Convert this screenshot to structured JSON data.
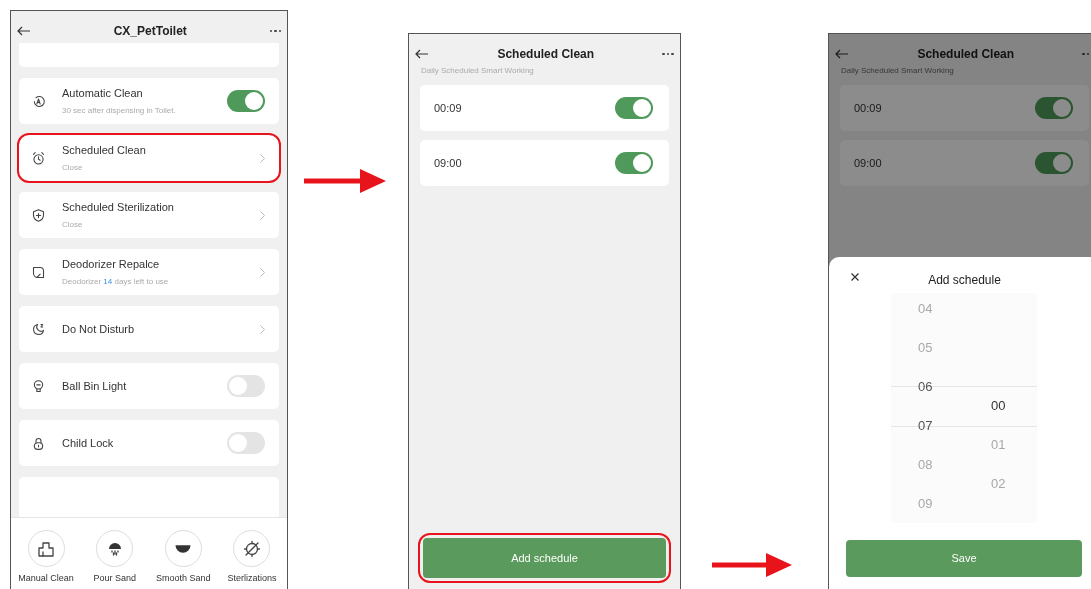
{
  "screens": [
    {
      "kind": "settings",
      "title": "CX_PetToilet",
      "rows": [
        {
          "kind": "blank"
        },
        {
          "kind": "toggle",
          "label": "Automatic Clean",
          "subtitle": [
            {
              "text": "30 sec after dispensing in Toilet.",
              "highlight": false
            }
          ],
          "on": true,
          "callout": false
        },
        {
          "kind": "link",
          "label": "Scheduled Clean",
          "subtitle": [
            {
              "text": "Close",
              "highlight": false
            }
          ],
          "callout": true
        },
        {
          "kind": "link",
          "label": "Scheduled Sterilization",
          "subtitle": [
            {
              "text": "Close",
              "highlight": false
            }
          ],
          "callout": false
        },
        {
          "kind": "link",
          "label": "Deodorizer Repalce",
          "subtitle": [
            {
              "text": "Deodorizer ",
              "highlight": false
            },
            {
              "text": "14",
              "highlight": true
            },
            {
              "text": " days left to use",
              "highlight": false
            }
          ],
          "callout": false
        },
        {
          "kind": "link",
          "label": "Do Not Disturb",
          "callout": false
        },
        {
          "kind": "toggle",
          "label": "Ball Bin Light",
          "on": false,
          "callout": false
        },
        {
          "kind": "toggle",
          "label": "Child Lock",
          "on": false,
          "callout": false
        },
        {
          "kind": "blank"
        }
      ],
      "actions": [
        {
          "label": "Manual Clean"
        },
        {
          "label": "Pour Sand"
        },
        {
          "label": "Smooth Sand"
        },
        {
          "label": "Sterlizations"
        }
      ]
    },
    {
      "kind": "schedule",
      "title": "Scheduled Clean",
      "subtitle": "Daily Scheduled Smart Working",
      "schedules": [
        {
          "time": "00:09",
          "on": true
        },
        {
          "time": "09:00",
          "on": true
        }
      ],
      "button": {
        "label": "Add schedule",
        "callout": true
      }
    },
    {
      "kind": "schedule",
      "title": "Scheduled Clean",
      "subtitle": "Daily Scheduled Smart Working",
      "schedules": [
        {
          "time": "00:09",
          "on": true
        },
        {
          "time": "09:00",
          "on": true
        }
      ],
      "sheet": {
        "title": "Add schedule",
        "hours": [
          {
            "value": "04",
            "selected": false
          },
          {
            "value": "05",
            "selected": false
          },
          {
            "value": "06",
            "selected": true
          },
          {
            "value": "07",
            "selected": true
          },
          {
            "value": "08",
            "selected": false
          },
          {
            "value": "09",
            "selected": false
          }
        ],
        "minutes": [
          {
            "value": "00",
            "selected": true
          },
          {
            "value": "01",
            "selected": false
          },
          {
            "value": "02",
            "selected": false
          }
        ],
        "button": "Save"
      }
    }
  ]
}
